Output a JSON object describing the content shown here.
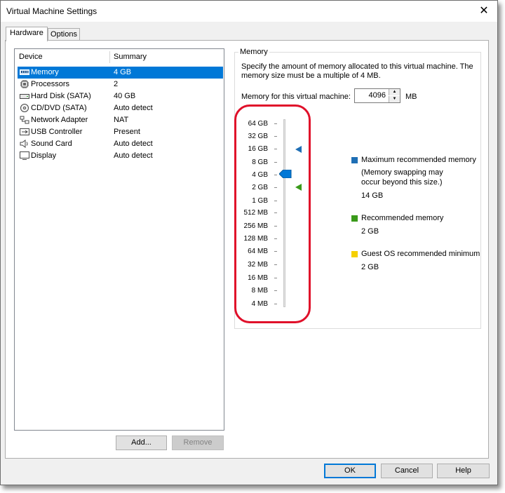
{
  "window": {
    "title": "Virtual Machine Settings",
    "close_label": "✕"
  },
  "tabs": [
    {
      "label": "Hardware",
      "active": true
    },
    {
      "label": "Options",
      "active": false
    }
  ],
  "device_list": {
    "headers": {
      "device": "Device",
      "summary": "Summary"
    },
    "rows": [
      {
        "name": "Memory",
        "summary": "4 GB",
        "icon": "memory-icon",
        "selected": true
      },
      {
        "name": "Processors",
        "summary": "2",
        "icon": "processor-icon"
      },
      {
        "name": "Hard Disk (SATA)",
        "summary": "40 GB",
        "icon": "hard-disk-icon"
      },
      {
        "name": "CD/DVD (SATA)",
        "summary": "Auto detect",
        "icon": "cd-dvd-icon"
      },
      {
        "name": "Network Adapter",
        "summary": "NAT",
        "icon": "network-adapter-icon"
      },
      {
        "name": "USB Controller",
        "summary": "Present",
        "icon": "usb-icon"
      },
      {
        "name": "Sound Card",
        "summary": "Auto detect",
        "icon": "speaker-icon"
      },
      {
        "name": "Display",
        "summary": "Auto detect",
        "icon": "monitor-icon"
      }
    ]
  },
  "list_buttons": {
    "add": "Add...",
    "remove": "Remove"
  },
  "memory_panel": {
    "group_title": "Memory",
    "description": "Specify the amount of memory allocated to this virtual machine. The memory size must be a multiple of 4 MB.",
    "field_label": "Memory for this virtual machine:",
    "value": "4096",
    "unit": "MB",
    "scale_labels": [
      "64 GB",
      "32 GB",
      "16 GB",
      "8 GB",
      "4 GB",
      "2 GB",
      "1 GB",
      "512 MB",
      "256 MB",
      "128 MB",
      "64 MB",
      "32 MB",
      "16 MB",
      "8 MB",
      "4 MB"
    ],
    "slider_value": "4 GB",
    "legend": {
      "max": {
        "label": "Maximum recommended memory",
        "note_line1": "(Memory swapping may",
        "note_line2": "occur beyond this size.)",
        "value": "14 GB",
        "color": "#1f6fb5"
      },
      "recommended": {
        "label": "Recommended memory",
        "value": "2 GB",
        "color": "#3a9a1a"
      },
      "guest_min": {
        "label": "Guest OS recommended minimum",
        "value": "2 GB",
        "color": "#f5d000"
      }
    }
  },
  "footer": {
    "ok": "OK",
    "cancel": "Cancel",
    "help": "Help"
  }
}
